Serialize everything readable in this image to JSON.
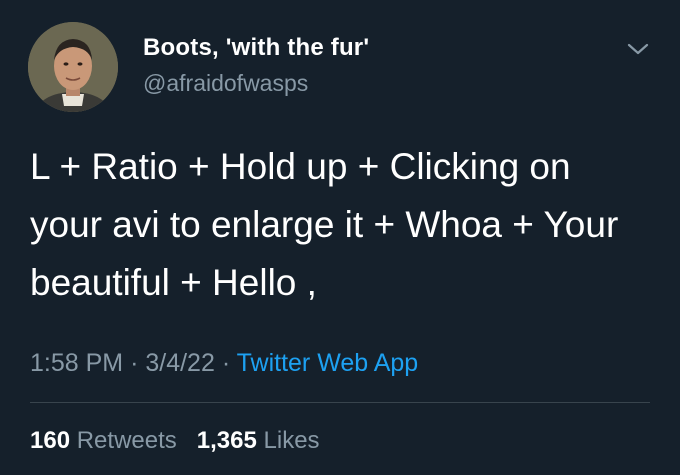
{
  "colors": {
    "background": "#15202b",
    "primary_text": "#ffffff",
    "secondary_text": "#8899a6",
    "link": "#1da1f2",
    "divider": "#38444d"
  },
  "author": {
    "display_name": "Boots, 'with the fur'",
    "handle": "@afraidofwasps",
    "avatar_icon": "user-avatar-photo"
  },
  "tweet": {
    "text_lines": [
      "L + Ratio + Hold up + Clicking on",
      "your avi to enlarge it + Whoa + Your",
      "beautiful + Hello ,"
    ]
  },
  "meta": {
    "time": "1:58 PM",
    "separator": "·",
    "date": "3/4/22",
    "source": "Twitter Web App"
  },
  "stats": {
    "retweets_count": "160",
    "retweets_label": "Retweets",
    "likes_count": "1,365",
    "likes_label": "Likes"
  },
  "icons": {
    "more": "chevron-down-icon"
  }
}
